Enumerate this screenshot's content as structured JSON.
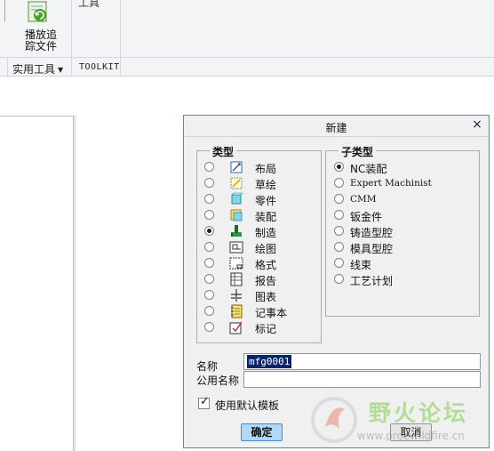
{
  "ribbon": {
    "play_button_label": "播放追\n踪文件",
    "tool_top_label": "工具",
    "group_utilities": "实用工具",
    "group_toolkit": "TOOLKIT"
  },
  "dialog": {
    "title": "新建",
    "close_glyph": "×",
    "type_group_title": "类型",
    "subtype_group_title": "子类型",
    "types": [
      {
        "label": "布局",
        "icon": "layout-icon",
        "checked": false
      },
      {
        "label": "草绘",
        "icon": "sketch-icon",
        "checked": false
      },
      {
        "label": "零件",
        "icon": "part-icon",
        "checked": false
      },
      {
        "label": "装配",
        "icon": "assembly-icon",
        "checked": false
      },
      {
        "label": "制造",
        "icon": "manufacturing-icon",
        "checked": true
      },
      {
        "label": "绘图",
        "icon": "drawing-icon",
        "checked": false
      },
      {
        "label": "格式",
        "icon": "format-icon",
        "checked": false
      },
      {
        "label": "报告",
        "icon": "report-icon",
        "checked": false
      },
      {
        "label": "图表",
        "icon": "diagram-icon",
        "checked": false
      },
      {
        "label": "记事本",
        "icon": "notebook-icon",
        "checked": false
      },
      {
        "label": "标记",
        "icon": "markup-icon",
        "checked": false
      }
    ],
    "subtypes": [
      {
        "label": "NC装配",
        "checked": true
      },
      {
        "label": "Expert Machinist",
        "checked": false
      },
      {
        "label": "CMM",
        "checked": false
      },
      {
        "label": "钣金件",
        "checked": false
      },
      {
        "label": "铸造型腔",
        "checked": false
      },
      {
        "label": "模具型腔",
        "checked": false
      },
      {
        "label": "线束",
        "checked": false
      },
      {
        "label": "工艺计划",
        "checked": false
      }
    ],
    "name_label": "名称",
    "name_value": "mfg0001",
    "common_name_label": "公用名称",
    "common_name_value": "",
    "use_default_template_label": "使用默认模板",
    "use_default_template_checked": true,
    "check_glyph": "✓",
    "ok_label": "确定",
    "cancel_label": "取消"
  },
  "watermark": {
    "text": "野火论坛",
    "url": "www.proewildfire.cn"
  },
  "colors": {
    "ok_button_bg": "#b3d7f5",
    "selection_bg": "#0a246a",
    "watermark_green": "#7ac943"
  }
}
